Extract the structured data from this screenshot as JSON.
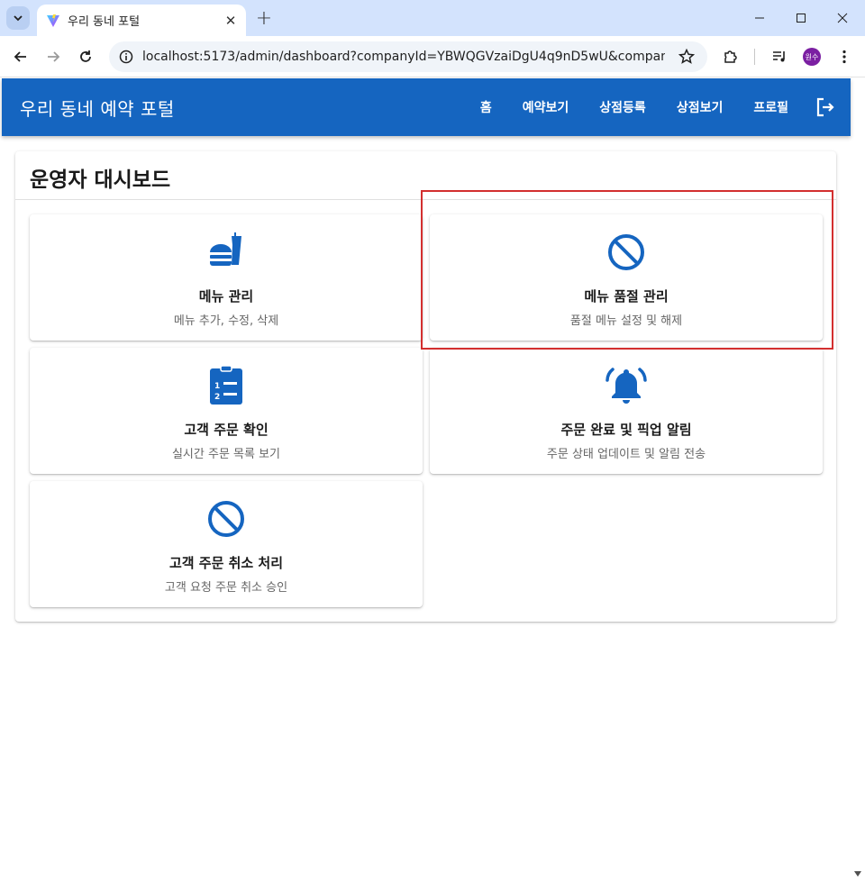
{
  "browser": {
    "tab_title": "우리 동네 포털",
    "url": "localhost:5173/admin/dashboard?companyId=YBWQGVzaiDgU4q9nD5wU&companyNam...",
    "profile_initials": "원수"
  },
  "appbar": {
    "brand": "우리 동네 예약 포털",
    "nav": [
      "홈",
      "예약보기",
      "상점등록",
      "상점보기",
      "프로필"
    ]
  },
  "dashboard": {
    "title": "운영자 대시보드",
    "cards": [
      {
        "title": "메뉴 관리",
        "desc": "메뉴 추가, 수정, 삭제",
        "icon": "fastfood-icon"
      },
      {
        "title": "메뉴 품절 관리",
        "desc": "품절 메뉴 설정 및 해제",
        "icon": "block-icon"
      },
      {
        "title": "고객 주문 확인",
        "desc": "실시간 주문 목록 보기",
        "icon": "clipboard-list-icon"
      },
      {
        "title": "주문 완료 및 픽업 알림",
        "desc": "주문 상태 업데이트 및 알림 전송",
        "icon": "bell-ringing-icon"
      },
      {
        "title": "고객 주문 취소 처리",
        "desc": "고객 요청 주문 취소 승인",
        "icon": "block-icon"
      }
    ]
  },
  "colors": {
    "primary": "#1565c0",
    "highlight": "#d32f2f",
    "tabstrip": "#d3e3fd"
  }
}
